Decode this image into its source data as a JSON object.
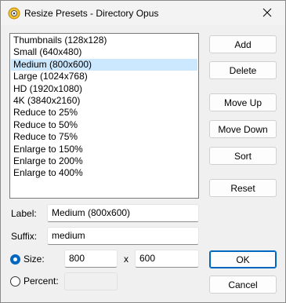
{
  "window": {
    "title": "Resize Presets - Directory Opus"
  },
  "presets": {
    "items": [
      "Thumbnails (128x128)",
      "Small (640x480)",
      "Medium (800x600)",
      "Large (1024x768)",
      "HD (1920x1080)",
      "4K (3840x2160)",
      "Reduce to 25%",
      "Reduce to 50%",
      "Reduce to 75%",
      "Enlarge to 150%",
      "Enlarge to 200%",
      "Enlarge to 400%"
    ],
    "selected_index": 2
  },
  "buttons": {
    "add": "Add",
    "delete": "Delete",
    "move_up": "Move Up",
    "move_down": "Move Down",
    "sort": "Sort",
    "reset": "Reset",
    "ok": "OK",
    "cancel": "Cancel"
  },
  "form": {
    "label_caption": "Label:",
    "label_value": "Medium (800x600)",
    "suffix_caption": "Suffix:",
    "suffix_value": "medium",
    "size_caption": "Size:",
    "size_width": "800",
    "size_separator": "x",
    "size_height": "600",
    "percent_caption": "Percent:",
    "percent_value": "",
    "size_selected": true
  },
  "colors": {
    "accent": "#0067c0",
    "selection": "#cce8ff"
  }
}
